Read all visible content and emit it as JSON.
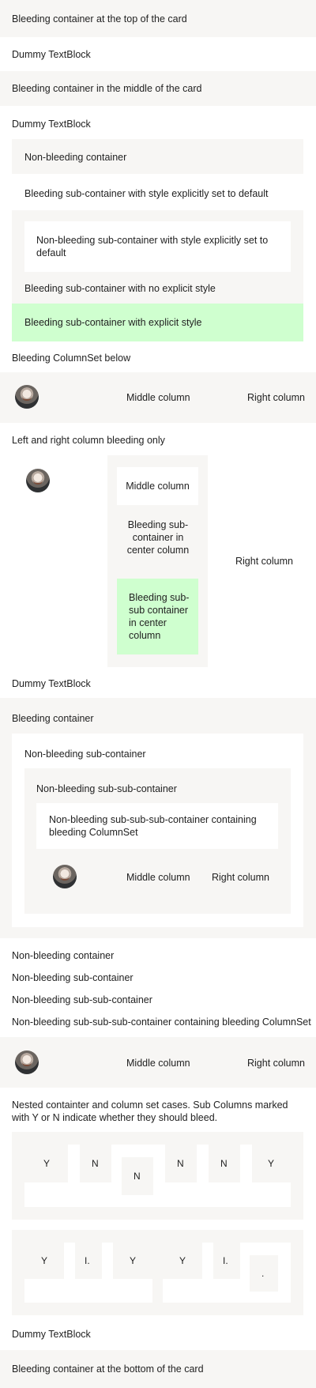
{
  "sections": {
    "bleed_top": "Bleeding container at the top of the card",
    "dummy_1": "Dummy TextBlock",
    "bleed_middle": "Bleeding container in the middle of the card",
    "dummy_2": "Dummy TextBlock",
    "non_bleed_container": "Non-bleeding container",
    "bleed_sub_default": "Bleeding sub-container with style explicitly set to default",
    "non_bleed_sub_default": "Non-bleeding sub-container with style explicitly set to default",
    "bleed_sub_no_style": "Bleeding sub-container with no explicit style",
    "bleed_sub_explicit": "Bleeding sub-container with explicit style",
    "bleed_columnset_below": "Bleeding ColumnSet below",
    "colset1_middle": "Middle column",
    "colset1_right": "Right column",
    "lr_bleed_title": "Left and right column bleeding only",
    "center_middle_column": "Middle column",
    "center_bleed_sub": "Bleeding sub-container in center column",
    "center_bleed_subsub": "Bleeding sub-sub container in center column",
    "lr_right_column": "Right column",
    "dummy_3": "Dummy TextBlock",
    "bleeding_container": "Bleeding container",
    "nb_sub": "Non-bleeding sub-container",
    "nb_subsub": "Non-bleeding sub-sub-container",
    "nb_subsubsub": "Non-bleeding sub-sub-sub-container containing bleeding ColumnSet",
    "colset2_middle": "Middle column",
    "colset2_right": "Right column",
    "plain_nb_container": "Non-bleeding container",
    "plain_nb_sub": "Non-bleeding sub-container",
    "plain_nb_subsub": "Non-bleeding sub-sub-container",
    "plain_nb_subsubsub": "Non-bleeding sub-sub-sub-container containing bleeding ColumnSet",
    "colset3_middle": "Middle column",
    "colset3_right": "Right column",
    "nested_title": "Nested containter and column set cases. Sub Columns marked with Y or N indicate whether they should bleed.",
    "nested_row1": [
      "Y",
      "N",
      "N",
      "N",
      "N",
      "Y"
    ],
    "nested_row2": [
      "Y",
      "I.",
      "Y",
      "Y",
      "I.",
      "."
    ],
    "dummy_4": "Dummy TextBlock",
    "bleed_bottom": "Bleeding container at the bottom of the card"
  },
  "colors": {
    "emphasis": "#f7f6f4",
    "good": "#cfffcf",
    "default": "#ffffff"
  }
}
